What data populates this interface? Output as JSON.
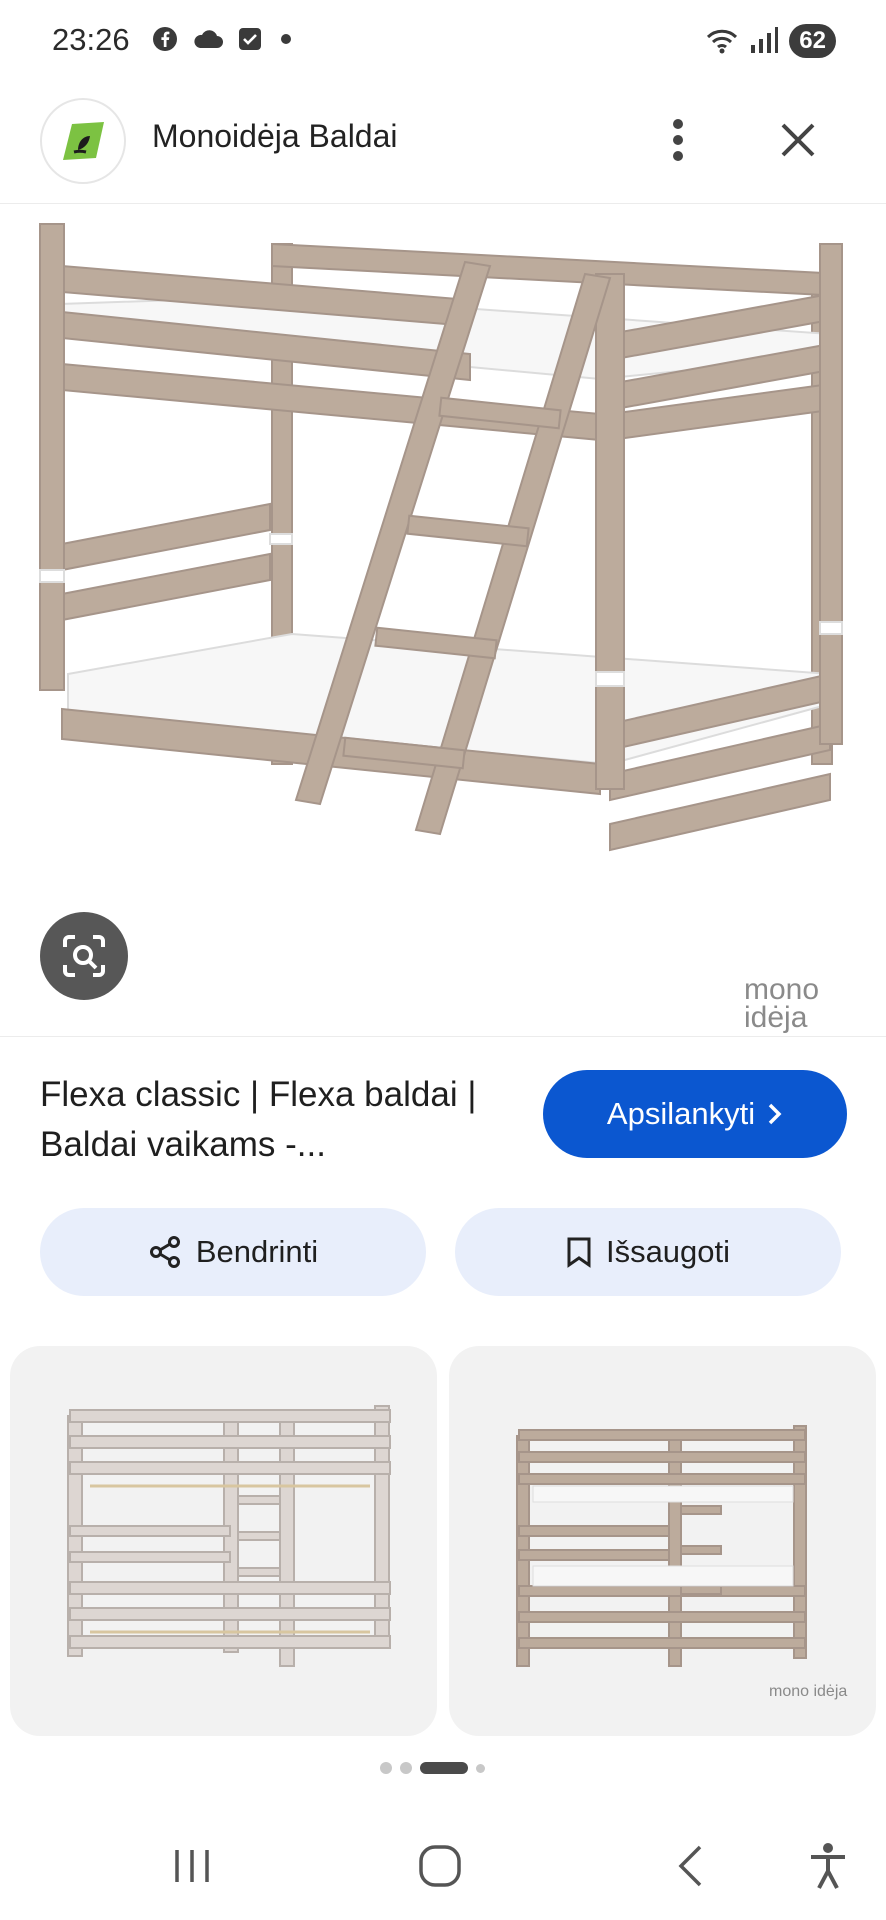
{
  "status_bar": {
    "time": "23:26",
    "battery": "62",
    "icons": [
      "facebook-icon",
      "cloud-icon",
      "check-box-icon",
      "dot-icon",
      "wifi-icon",
      "signal-icon"
    ]
  },
  "header": {
    "site_name": "Monoidėja Baldai",
    "menu_icon": "more-vert-icon",
    "close_icon": "close-icon"
  },
  "main_image": {
    "watermark_line1": "mono",
    "watermark_line2": "idėja"
  },
  "result": {
    "title": "Flexa classic | Flexa baldai | Baldai vaikams -...",
    "visit_label": "Apsilankyti"
  },
  "actions": {
    "share_label": "Bendrinti",
    "save_label": "Išsaugoti"
  },
  "related": {
    "cards": [
      {
        "watermark": ""
      },
      {
        "watermark": "mono idėja"
      }
    ]
  },
  "pager": {
    "count": 4,
    "active_index": 2
  },
  "nav": [
    "recents-icon",
    "home-icon",
    "back-icon",
    "accessibility-icon"
  ],
  "colors": {
    "accent": "#0b57d0",
    "pill_bg": "#e8eefb",
    "wood": "#bba99a"
  }
}
